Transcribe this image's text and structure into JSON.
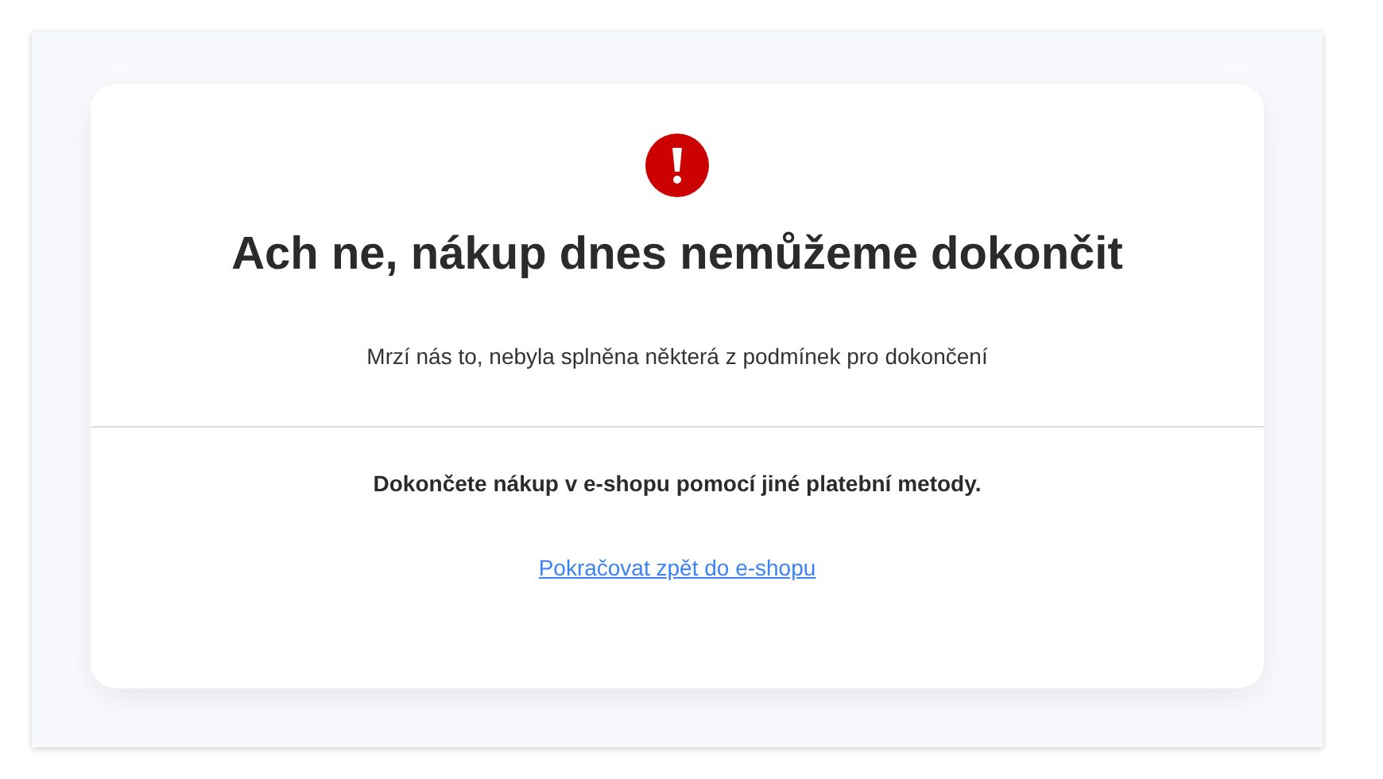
{
  "error_card": {
    "title": "Ach ne, nákup dnes nemůžeme dokončit",
    "message": "Mrzí nás to, nebyla splněna některá z podmínek pro dokončení",
    "instruction": "Dokončete nákup v e-shopu pomocí jiné platební metody.",
    "link": "Pokračovat zpět do e-shopu"
  }
}
